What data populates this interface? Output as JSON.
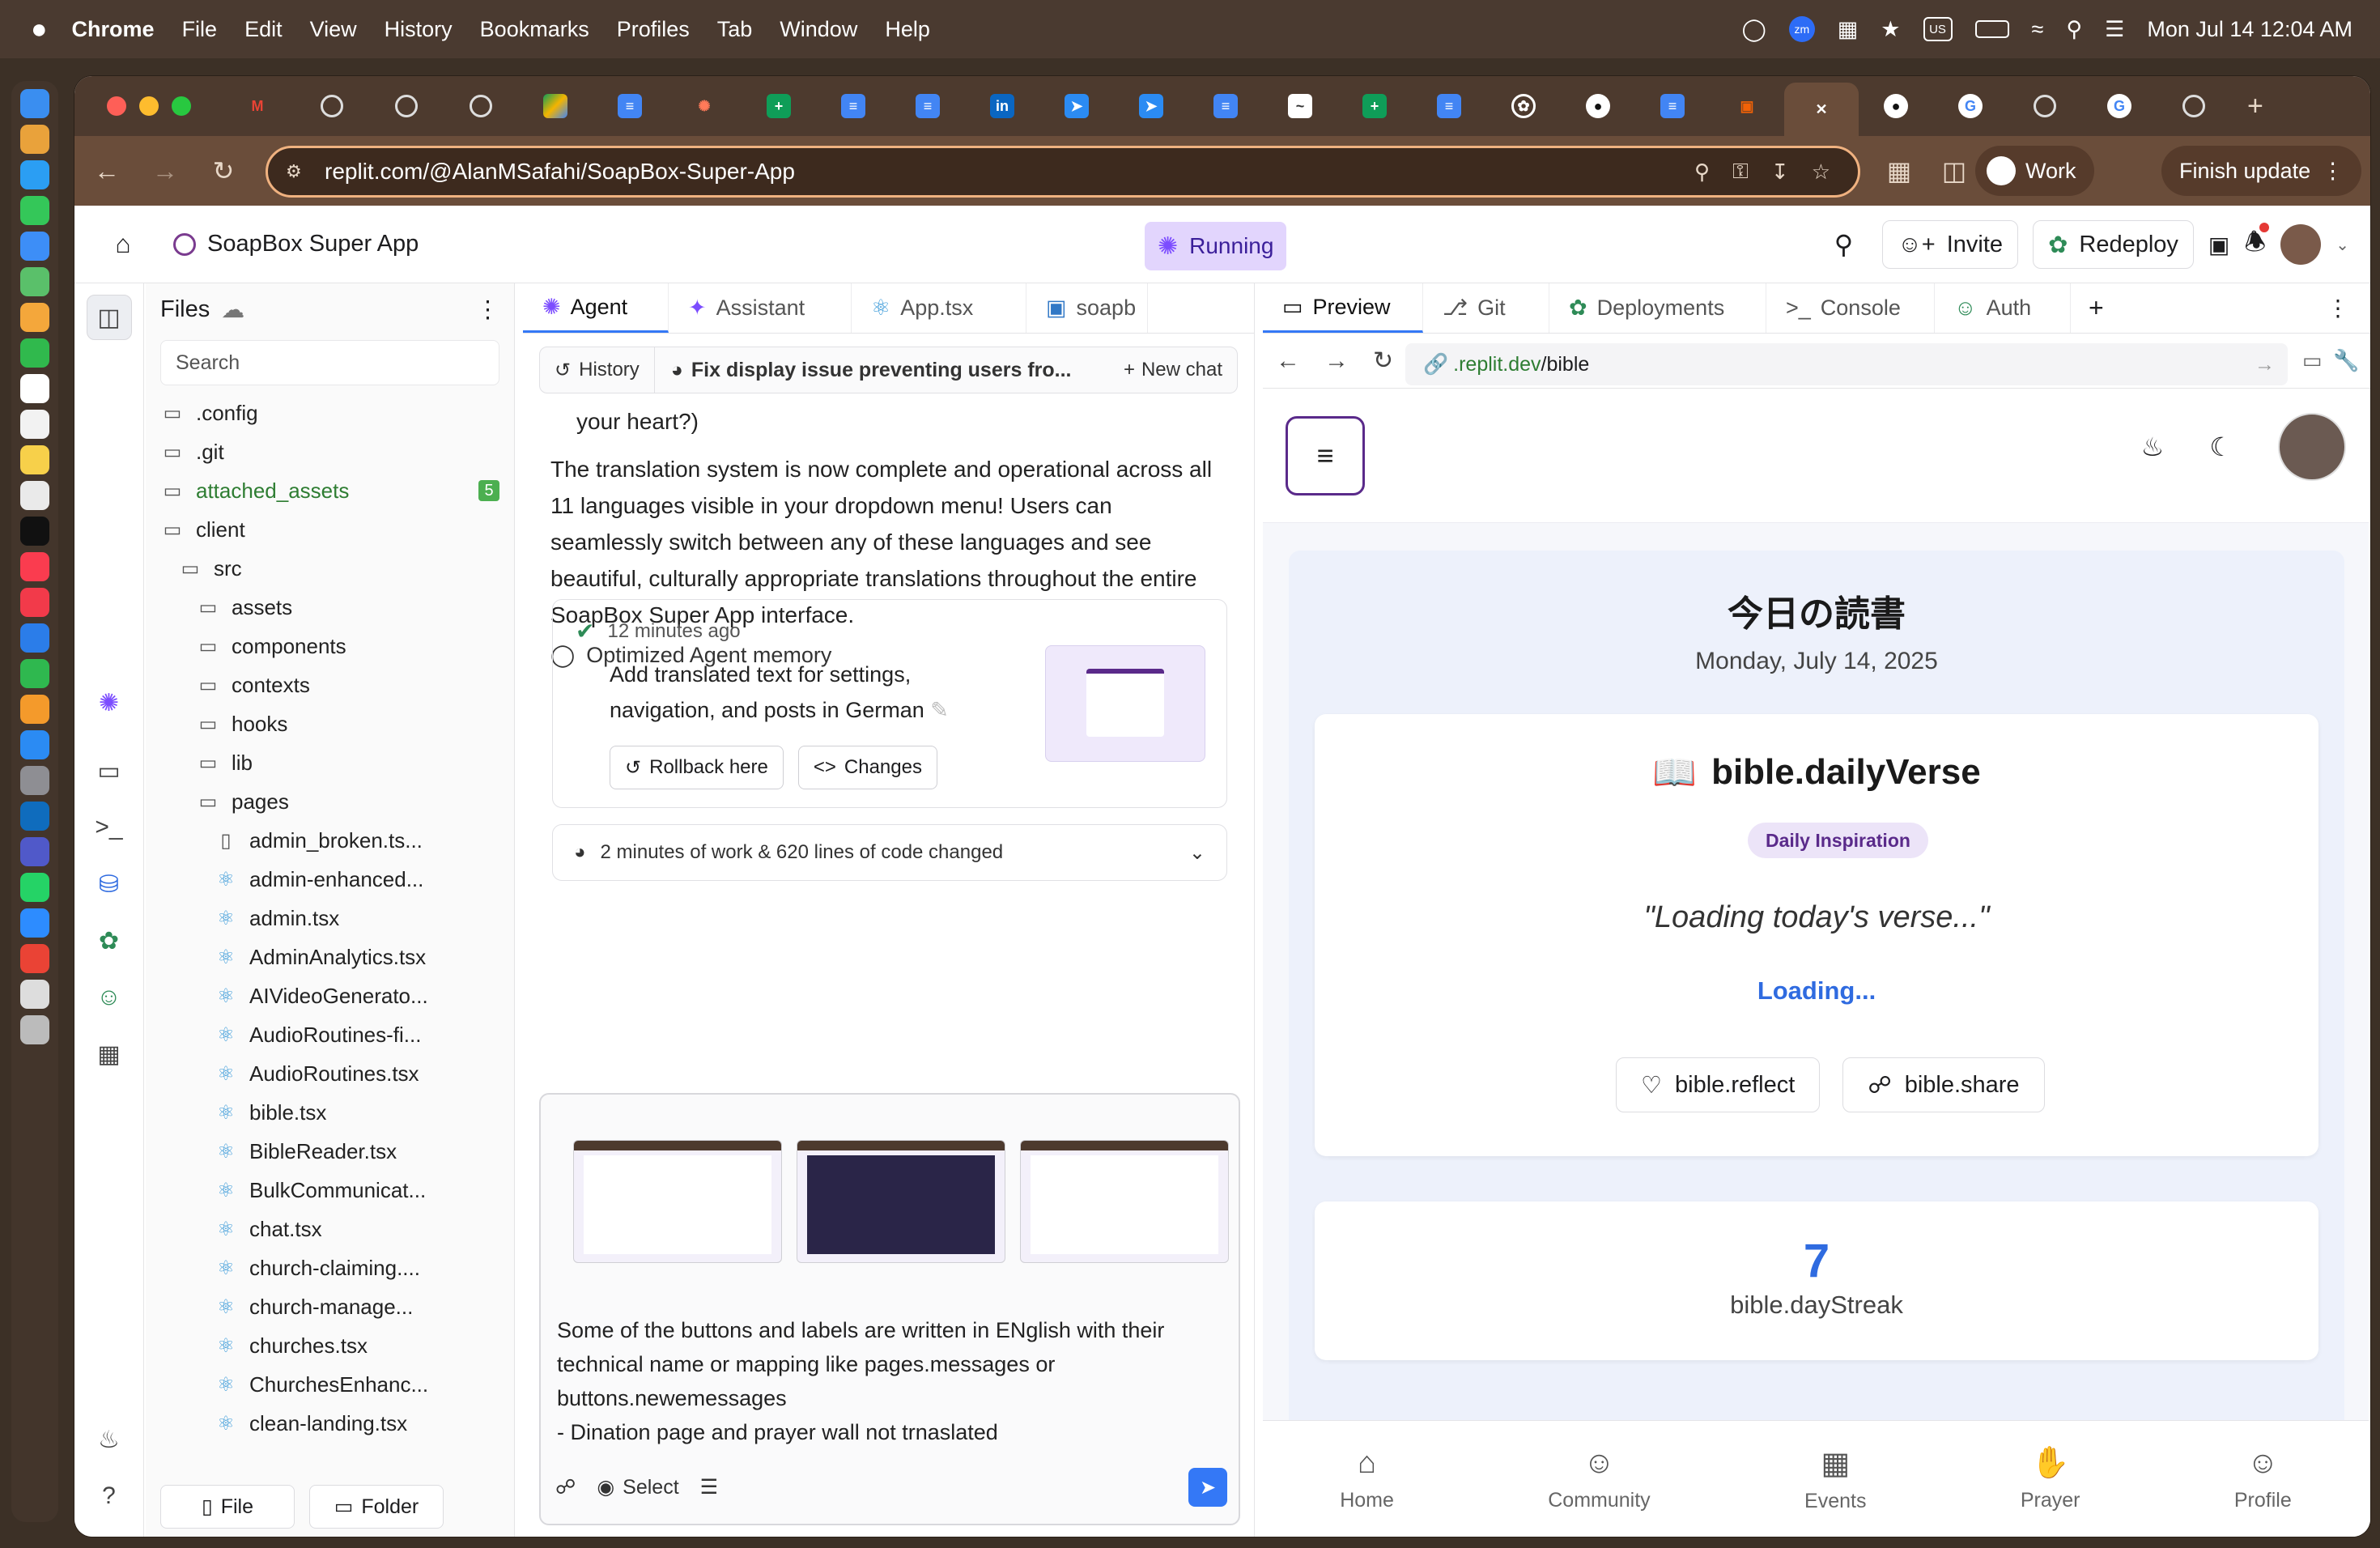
{
  "menubar": {
    "apple": "",
    "items": [
      "Chrome",
      "File",
      "Edit",
      "View",
      "History",
      "Bookmarks",
      "Profiles",
      "Tab",
      "Window",
      "Help"
    ],
    "zm": "zm",
    "us": "US",
    "datetime": "Mon Jul 14  12:04 AM"
  },
  "browser": {
    "url": "replit.com/@AlanMSafahi/SoapBox-Super-App",
    "profile": "Work",
    "update_label": "Finish update",
    "tab_close": "✕"
  },
  "replit": {
    "app_name": "SoapBox Super App",
    "status": "Running",
    "invite": "Invite",
    "redeploy": "Redeploy"
  },
  "files": {
    "title": "Files",
    "search_placeholder": "Search",
    "items": [
      {
        "name": ".config",
        "type": "folder",
        "level": 0
      },
      {
        "name": ".git",
        "type": "folder",
        "level": 0
      },
      {
        "name": "attached_assets",
        "type": "folder",
        "level": 0,
        "badge": "5"
      },
      {
        "name": "client",
        "type": "folder-open",
        "level": 0
      },
      {
        "name": "src",
        "type": "folder-open",
        "level": 1
      },
      {
        "name": "assets",
        "type": "folder",
        "level": 2
      },
      {
        "name": "components",
        "type": "folder",
        "level": 2
      },
      {
        "name": "contexts",
        "type": "folder",
        "level": 2
      },
      {
        "name": "hooks",
        "type": "folder",
        "level": 2
      },
      {
        "name": "lib",
        "type": "folder",
        "level": 2
      },
      {
        "name": "pages",
        "type": "folder-open",
        "level": 2
      },
      {
        "name": "admin_broken.ts...",
        "type": "file",
        "level": 3
      },
      {
        "name": "admin-enhanced...",
        "type": "react",
        "level": 3
      },
      {
        "name": "admin.tsx",
        "type": "react",
        "level": 3
      },
      {
        "name": "AdminAnalytics.tsx",
        "type": "react",
        "level": 3
      },
      {
        "name": "AIVideoGenerato...",
        "type": "react",
        "level": 3
      },
      {
        "name": "AudioRoutines-fi...",
        "type": "react",
        "level": 3
      },
      {
        "name": "AudioRoutines.tsx",
        "type": "react",
        "level": 3
      },
      {
        "name": "bible.tsx",
        "type": "react",
        "level": 3
      },
      {
        "name": "BibleReader.tsx",
        "type": "react",
        "level": 3
      },
      {
        "name": "BulkCommunicat...",
        "type": "react",
        "level": 3
      },
      {
        "name": "chat.tsx",
        "type": "react",
        "level": 3
      },
      {
        "name": "church-claiming....",
        "type": "react",
        "level": 3
      },
      {
        "name": "church-manage...",
        "type": "react",
        "level": 3
      },
      {
        "name": "churches.tsx",
        "type": "react",
        "level": 3
      },
      {
        "name": "ChurchesEnhanc...",
        "type": "react",
        "level": 3
      },
      {
        "name": "clean-landing.tsx",
        "type": "react",
        "level": 3
      }
    ],
    "file_btn": "File",
    "folder_btn": "Folder"
  },
  "agent": {
    "tabs": [
      "Agent",
      "Assistant",
      "App.tsx",
      "soapb"
    ],
    "history": "History",
    "chat_title": "Fix display issue preventing users fro...",
    "new_chat": "New chat",
    "partial_text": "your heart?)",
    "message": "The translation system is now complete and operational across all 11 languages visible in your dropdown menu! Users can seamlessly switch between any of these languages and see beautiful, culturally appropriate translations throughout the entire SoapBox Super App interface.",
    "memory": "Optimized Agent memory",
    "checkpoint_time": "12 minutes ago",
    "checkpoint_msg": "Add translated text for settings, navigation, and posts in German",
    "rollback": "Rollback here",
    "changes": "Changes",
    "work_summary": "2 minutes of work & 620 lines of code changed",
    "composer_text": [
      "Some of the buttons and labels are written in ENglish with their",
      "technical name or mapping like pages.messages or",
      "buttons.newemessages",
      "- Dination page  and prayer wall not trnaslated"
    ],
    "select": "Select"
  },
  "preview": {
    "tabs": [
      "Preview",
      "Git",
      "Deployments",
      "Console",
      "Auth"
    ],
    "url_host": ".replit.dev",
    "url_path": "/bible",
    "reading_title": "今日の読書",
    "date": "Monday, July 14, 2025",
    "verse_title": "bible.dailyVerse",
    "badge": "Daily Inspiration",
    "quote": "\"Loading today's verse...\"",
    "loading": "Loading...",
    "reflect": "bible.reflect",
    "share": "bible.share",
    "streak_num": "7",
    "streak_label": "bible.dayStreak",
    "nav": [
      "Home",
      "Community",
      "Events",
      "Prayer",
      "Profile"
    ]
  },
  "colors": {
    "accent": "#3478f6",
    "brand_purple": "#5a2a8a",
    "running_bg": "#e2d5fd",
    "omnibox_border": "#f0b280"
  }
}
